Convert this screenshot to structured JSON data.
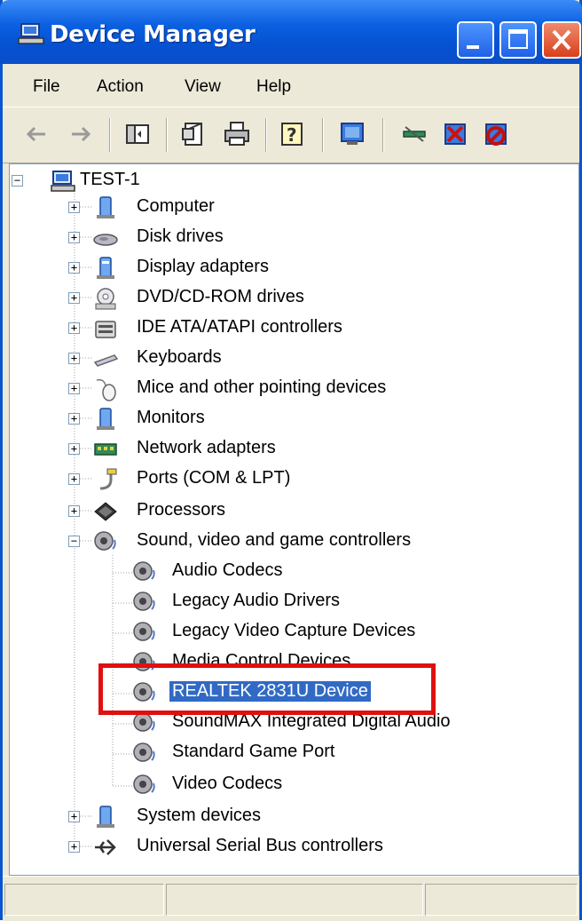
{
  "window": {
    "title": "Device Manager"
  },
  "menu": {
    "items": [
      "File",
      "Action",
      "View",
      "Help"
    ]
  },
  "tree": {
    "root": "TEST-1",
    "categories": [
      {
        "label": "Computer",
        "icon": "computer-icon"
      },
      {
        "label": "Disk drives",
        "icon": "disk-drive-icon"
      },
      {
        "label": "Display adapters",
        "icon": "display-adapter-icon"
      },
      {
        "label": "DVD/CD-ROM drives",
        "icon": "dvd-drive-icon"
      },
      {
        "label": "IDE ATA/ATAPI controllers",
        "icon": "ide-controller-icon"
      },
      {
        "label": "Keyboards",
        "icon": "keyboard-icon"
      },
      {
        "label": "Mice and other pointing devices",
        "icon": "mouse-icon"
      },
      {
        "label": "Monitors",
        "icon": "monitor-icon"
      },
      {
        "label": "Network adapters",
        "icon": "network-adapter-icon"
      },
      {
        "label": "Ports (COM & LPT)",
        "icon": "port-icon"
      },
      {
        "label": "Processors",
        "icon": "processor-icon"
      },
      {
        "label": "Sound, video and game controllers",
        "icon": "sound-icon"
      }
    ],
    "sound_children": [
      "Audio Codecs",
      "Legacy Audio Drivers",
      "Legacy Video Capture Devices",
      "Media Control Devices",
      "REALTEK 2831U Device",
      "SoundMAX Integrated Digital Audio",
      "Standard Game Port",
      "Video Codecs"
    ],
    "bottom_categories": [
      {
        "label": "System devices",
        "icon": "system-device-icon"
      },
      {
        "label": "Universal Serial Bus controllers",
        "icon": "usb-icon"
      }
    ],
    "selected": "REALTEK 2831U Device"
  },
  "colors": {
    "selection": "#316AC5",
    "highlight_border": "#E01010",
    "titlebar": "#0A5FE0"
  }
}
